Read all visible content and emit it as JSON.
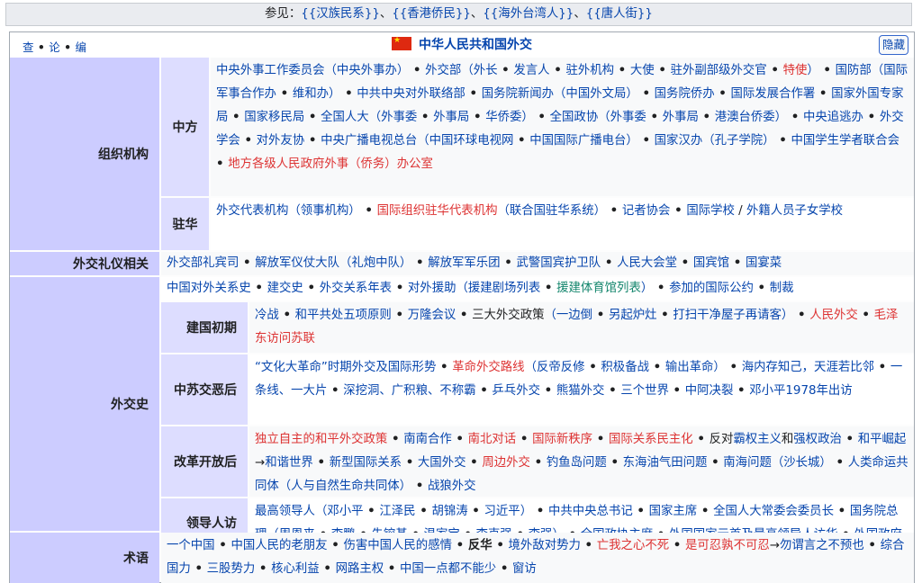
{
  "see_also": {
    "label": "参见：",
    "links": [
      "{{汉族民系}}",
      "{{香港侨民}}",
      "{{海外台湾人}}",
      "{{唐人街}}"
    ],
    "sep": "、"
  },
  "vde": {
    "v": "查",
    "d": "论",
    "e": "编"
  },
  "title": "中华人民共和国外交",
  "hide_label": "隐藏",
  "groups": {
    "org": "组织机构",
    "ceremony": "外交礼仪相关",
    "history": "外交史",
    "terms": "术语"
  },
  "subgroups": {
    "zhongfang": "中方",
    "zhuhua": "驻华",
    "jianguo": "建国初期",
    "zhongsu": "中苏交恶后",
    "gaige": "改革开放后",
    "lingdao": "领导人访问列表"
  },
  "rows": {
    "zhongfang": [
      {
        "t": "中央外事工作委员会",
        "c": "a"
      },
      {
        "t": "（中央外事办）",
        "c": "a"
      },
      {
        "t": " • ",
        "c": "dot"
      },
      {
        "t": "外交部",
        "c": "a"
      },
      {
        "t": "（外长",
        "c": "a"
      },
      {
        "t": " • ",
        "c": "dot"
      },
      {
        "t": "发言人",
        "c": "a"
      },
      {
        "t": " • ",
        "c": "dot"
      },
      {
        "t": "驻外机构",
        "c": "a"
      },
      {
        "t": " • ",
        "c": "dot"
      },
      {
        "t": "大使",
        "c": "a"
      },
      {
        "t": " • ",
        "c": "dot"
      },
      {
        "t": "驻外副部级外交官",
        "c": "a"
      },
      {
        "t": " • ",
        "c": "dot"
      },
      {
        "t": "特使",
        "c": "r"
      },
      {
        "t": "）",
        "c": "a"
      },
      {
        "t": " • ",
        "c": "dot"
      },
      {
        "t": "国防部",
        "c": "a"
      },
      {
        "t": "（国际军事合作办",
        "c": "a"
      },
      {
        "t": " • ",
        "c": "dot"
      },
      {
        "t": "维和办）",
        "c": "a"
      },
      {
        "t": " • ",
        "c": "dot"
      },
      {
        "t": "中共中央对外联络部",
        "c": "a"
      },
      {
        "t": " • ",
        "c": "dot"
      },
      {
        "t": "国务院新闻办",
        "c": "a"
      },
      {
        "t": "（中国外文局）",
        "c": "a"
      },
      {
        "t": " • ",
        "c": "dot"
      },
      {
        "t": "国务院侨办",
        "c": "a"
      },
      {
        "t": " • ",
        "c": "dot"
      },
      {
        "t": "国际发展合作署",
        "c": "a"
      },
      {
        "t": " • ",
        "c": "dot"
      },
      {
        "t": "国家外国专家局",
        "c": "a"
      },
      {
        "t": " • ",
        "c": "dot"
      },
      {
        "t": "国家移民局",
        "c": "a"
      },
      {
        "t": " • ",
        "c": "dot"
      },
      {
        "t": "全国人大",
        "c": "a"
      },
      {
        "t": "（外事委",
        "c": "a"
      },
      {
        "t": " • ",
        "c": "dot"
      },
      {
        "t": "外事局",
        "c": "a"
      },
      {
        "t": " • ",
        "c": "dot"
      },
      {
        "t": "华侨委）",
        "c": "a"
      },
      {
        "t": " • ",
        "c": "dot"
      },
      {
        "t": "全国政协",
        "c": "a"
      },
      {
        "t": "（外事委",
        "c": "a"
      },
      {
        "t": " • ",
        "c": "dot"
      },
      {
        "t": "外事局",
        "c": "a"
      },
      {
        "t": " • ",
        "c": "dot"
      },
      {
        "t": "港澳台侨委）",
        "c": "a"
      },
      {
        "t": " • ",
        "c": "dot"
      },
      {
        "t": "中央追逃办",
        "c": "a"
      },
      {
        "t": " • ",
        "c": "dot"
      },
      {
        "t": "外交学会",
        "c": "a"
      },
      {
        "t": " • ",
        "c": "dot"
      },
      {
        "t": "对外友协",
        "c": "a"
      },
      {
        "t": " • ",
        "c": "dot"
      },
      {
        "t": "中央广播电视总台",
        "c": "a"
      },
      {
        "t": "（中国环球电视网",
        "c": "a"
      },
      {
        "t": " • ",
        "c": "dot"
      },
      {
        "t": "中国国际广播电台）",
        "c": "a"
      },
      {
        "t": " • ",
        "c": "dot"
      },
      {
        "t": "国家汉办",
        "c": "a"
      },
      {
        "t": "（孔子学院）",
        "c": "a"
      },
      {
        "t": " • ",
        "c": "dot"
      },
      {
        "t": "中国学生学者联合会",
        "c": "a"
      },
      {
        "t": " • ",
        "c": "dot"
      },
      {
        "t": "地方各级人民政府外事（侨务）办公室",
        "c": "r"
      }
    ],
    "zhuhua": [
      {
        "t": "外交代表机构",
        "c": "a"
      },
      {
        "t": "（领事机构）",
        "c": "a"
      },
      {
        "t": " • ",
        "c": "dot"
      },
      {
        "t": "国际组织驻华代表机构",
        "c": "r"
      },
      {
        "t": "（联合国驻华系统）",
        "c": "a"
      },
      {
        "t": " • ",
        "c": "dot"
      },
      {
        "t": "记者协会",
        "c": "a"
      },
      {
        "t": " • ",
        "c": "dot"
      },
      {
        "t": "国际学校",
        "c": "a"
      },
      {
        "t": " / ",
        "c": "t"
      },
      {
        "t": "外籍人员子女学校",
        "c": "a"
      }
    ],
    "ceremony": [
      {
        "t": "外交部礼宾司",
        "c": "a"
      },
      {
        "t": " • ",
        "c": "dot"
      },
      {
        "t": "解放军仪仗大队",
        "c": "a"
      },
      {
        "t": "（礼炮中队）",
        "c": "a"
      },
      {
        "t": " • ",
        "c": "dot"
      },
      {
        "t": "解放军军乐团",
        "c": "a"
      },
      {
        "t": " • ",
        "c": "dot"
      },
      {
        "t": "武警国宾护卫队",
        "c": "a"
      },
      {
        "t": " • ",
        "c": "dot"
      },
      {
        "t": "人民大会堂",
        "c": "a"
      },
      {
        "t": " • ",
        "c": "dot"
      },
      {
        "t": "国宾馆",
        "c": "a"
      },
      {
        "t": " • ",
        "c": "dot"
      },
      {
        "t": "国宴菜",
        "c": "a"
      }
    ],
    "history_top": [
      {
        "t": "中国对外关系史",
        "c": "a"
      },
      {
        "t": " • ",
        "c": "dot"
      },
      {
        "t": "建交史",
        "c": "a"
      },
      {
        "t": " • ",
        "c": "dot"
      },
      {
        "t": "外交关系年表",
        "c": "a"
      },
      {
        "t": " • ",
        "c": "dot"
      },
      {
        "t": "对外援助",
        "c": "a"
      },
      {
        "t": "（援建剧场列表",
        "c": "a"
      },
      {
        "t": " • ",
        "c": "dot"
      },
      {
        "t": "援建体育馆列表",
        "c": "g"
      },
      {
        "t": "）",
        "c": "a"
      },
      {
        "t": " • ",
        "c": "dot"
      },
      {
        "t": "参加的国际公约",
        "c": "a"
      },
      {
        "t": " • ",
        "c": "dot"
      },
      {
        "t": "制裁",
        "c": "a"
      }
    ],
    "jianguo": [
      {
        "t": "冷战",
        "c": "a"
      },
      {
        "t": " • ",
        "c": "dot"
      },
      {
        "t": "和平共处五项原则",
        "c": "a"
      },
      {
        "t": " • ",
        "c": "dot"
      },
      {
        "t": "万隆会议",
        "c": "a"
      },
      {
        "t": " • ",
        "c": "dot"
      },
      {
        "t": "三大外交政策",
        "c": "t"
      },
      {
        "t": "（一边倒",
        "c": "a"
      },
      {
        "t": " • ",
        "c": "dot"
      },
      {
        "t": "另起炉灶",
        "c": "a"
      },
      {
        "t": " • ",
        "c": "dot"
      },
      {
        "t": "打扫干净屋子再请客）",
        "c": "a"
      },
      {
        "t": " • ",
        "c": "dot"
      },
      {
        "t": "人民外交",
        "c": "r"
      },
      {
        "t": " • ",
        "c": "dot"
      },
      {
        "t": "毛泽东访问苏联",
        "c": "r"
      }
    ],
    "zhongsu": [
      {
        "t": "“文化大革命”时期外交及国际形势",
        "c": "a"
      },
      {
        "t": " • ",
        "c": "dot"
      },
      {
        "t": "革命外交路线",
        "c": "r"
      },
      {
        "t": "（反帝反修",
        "c": "a"
      },
      {
        "t": " • ",
        "c": "dot"
      },
      {
        "t": "积极备战",
        "c": "a"
      },
      {
        "t": " • ",
        "c": "dot"
      },
      {
        "t": "输出革命）",
        "c": "a"
      },
      {
        "t": " • ",
        "c": "dot"
      },
      {
        "t": "海内存知己，天涯若比邻",
        "c": "a"
      },
      {
        "t": " • ",
        "c": "dot"
      },
      {
        "t": "一条线、一大片",
        "c": "a"
      },
      {
        "t": " • ",
        "c": "dot"
      },
      {
        "t": "深挖洞、广积粮、不称霸",
        "c": "a"
      },
      {
        "t": " • ",
        "c": "dot"
      },
      {
        "t": "乒乓外交",
        "c": "a"
      },
      {
        "t": " • ",
        "c": "dot"
      },
      {
        "t": "熊猫外交",
        "c": "a"
      },
      {
        "t": " • ",
        "c": "dot"
      },
      {
        "t": "三个世界",
        "c": "a"
      },
      {
        "t": " • ",
        "c": "dot"
      },
      {
        "t": "中阿决裂",
        "c": "a"
      },
      {
        "t": " • ",
        "c": "dot"
      },
      {
        "t": "邓小平1978年出访",
        "c": "a"
      }
    ],
    "gaige": [
      {
        "t": "独立自主的和平外交政策",
        "c": "r"
      },
      {
        "t": " • ",
        "c": "dot"
      },
      {
        "t": "南南合作",
        "c": "a"
      },
      {
        "t": " • ",
        "c": "dot"
      },
      {
        "t": "南北对话",
        "c": "r"
      },
      {
        "t": " • ",
        "c": "dot"
      },
      {
        "t": "国际新秩序",
        "c": "r"
      },
      {
        "t": " • ",
        "c": "dot"
      },
      {
        "t": "国际关系民主化",
        "c": "r"
      },
      {
        "t": " • ",
        "c": "dot"
      },
      {
        "t": "反对",
        "c": "t"
      },
      {
        "t": "霸权主义",
        "c": "a"
      },
      {
        "t": "和",
        "c": "t"
      },
      {
        "t": "强权政治",
        "c": "a"
      },
      {
        "t": " • ",
        "c": "dot"
      },
      {
        "t": "和平崛起",
        "c": "a"
      },
      {
        "t": "→",
        "c": "t"
      },
      {
        "t": "和谐世界",
        "c": "a"
      },
      {
        "t": " • ",
        "c": "dot"
      },
      {
        "t": "新型国际关系",
        "c": "a"
      },
      {
        "t": " • ",
        "c": "dot"
      },
      {
        "t": "大国外交",
        "c": "a"
      },
      {
        "t": " • ",
        "c": "dot"
      },
      {
        "t": "周边外交",
        "c": "r"
      },
      {
        "t": " • ",
        "c": "dot"
      },
      {
        "t": "钓鱼岛问题",
        "c": "a"
      },
      {
        "t": " • ",
        "c": "dot"
      },
      {
        "t": "东海油气田问题",
        "c": "a"
      },
      {
        "t": " • ",
        "c": "dot"
      },
      {
        "t": "南海问题",
        "c": "a"
      },
      {
        "t": "（沙长城）",
        "c": "a"
      },
      {
        "t": " • ",
        "c": "dot"
      },
      {
        "t": "人类命运共同体",
        "c": "a"
      },
      {
        "t": "（人与自然生命共同体）",
        "c": "a"
      },
      {
        "t": " • ",
        "c": "dot"
      },
      {
        "t": "战狼外交",
        "c": "a"
      }
    ],
    "lingdao": [
      {
        "t": "最高领导人",
        "c": "a"
      },
      {
        "t": "（邓小平",
        "c": "a"
      },
      {
        "t": " • ",
        "c": "dot"
      },
      {
        "t": "江泽民",
        "c": "a"
      },
      {
        "t": " • ",
        "c": "dot"
      },
      {
        "t": "胡锦涛",
        "c": "a"
      },
      {
        "t": " • ",
        "c": "dot"
      },
      {
        "t": "习近平）",
        "c": "a"
      },
      {
        "t": " • ",
        "c": "dot"
      },
      {
        "t": "中共中央总书记",
        "c": "a"
      },
      {
        "t": " • ",
        "c": "dot"
      },
      {
        "t": "国家主席",
        "c": "a"
      },
      {
        "t": " • ",
        "c": "dot"
      },
      {
        "t": "全国人大常委会委员长",
        "c": "a"
      },
      {
        "t": " • ",
        "c": "dot"
      },
      {
        "t": "国务院总理",
        "c": "a"
      },
      {
        "t": "（周恩来",
        "c": "a"
      },
      {
        "t": " • ",
        "c": "dot"
      },
      {
        "t": "李鹏",
        "c": "a"
      },
      {
        "t": " • ",
        "c": "dot"
      },
      {
        "t": "朱镕基",
        "c": "a"
      },
      {
        "t": " • ",
        "c": "dot"
      },
      {
        "t": "温家宝",
        "c": "a"
      },
      {
        "t": " • ",
        "c": "dot"
      },
      {
        "t": "李克强",
        "c": "a"
      },
      {
        "t": " • ",
        "c": "dot"
      },
      {
        "t": "李强）",
        "c": "a"
      },
      {
        "t": " • ",
        "c": "dot"
      },
      {
        "t": "全国政协主席",
        "c": "a"
      },
      {
        "t": " • ",
        "c": "dot"
      },
      {
        "t": "外国国家元首及最高领导人访华",
        "c": "a"
      },
      {
        "t": " • ",
        "c": "dot"
      },
      {
        "t": "外国政府首脑访华",
        "c": "a"
      }
    ],
    "terms": [
      {
        "t": "一个中国",
        "c": "a"
      },
      {
        "t": " • ",
        "c": "dot"
      },
      {
        "t": "中国人民的老朋友",
        "c": "a"
      },
      {
        "t": " • ",
        "c": "dot"
      },
      {
        "t": "伤害中国人民的感情",
        "c": "a"
      },
      {
        "t": " • ",
        "c": "dot"
      },
      {
        "t": "反华",
        "c": "b"
      },
      {
        "t": " • ",
        "c": "dot"
      },
      {
        "t": "境外敌对势力",
        "c": "a"
      },
      {
        "t": " • ",
        "c": "dot"
      },
      {
        "t": "亡我之心不死",
        "c": "r"
      },
      {
        "t": " • ",
        "c": "dot"
      },
      {
        "t": "是可忍孰不可忍",
        "c": "r"
      },
      {
        "t": "→",
        "c": "t"
      },
      {
        "t": "勿谓言之不预也",
        "c": "a"
      },
      {
        "t": " • ",
        "c": "dot"
      },
      {
        "t": "综合国力",
        "c": "a"
      },
      {
        "t": " • ",
        "c": "dot"
      },
      {
        "t": "三股势力",
        "c": "a"
      },
      {
        "t": " • ",
        "c": "dot"
      },
      {
        "t": "核心利益",
        "c": "a"
      },
      {
        "t": " • ",
        "c": "dot"
      },
      {
        "t": "网路主权",
        "c": "a"
      },
      {
        "t": " • ",
        "c": "dot"
      },
      {
        "t": "中国一点都不能少",
        "c": "a"
      },
      {
        "t": " • ",
        "c": "dot"
      },
      {
        "t": "窗访",
        "c": "a"
      }
    ]
  },
  "colors": {
    "link": "#0645ad",
    "redlink": "#d33",
    "visited": "#14866d",
    "group": "#ccccff",
    "subgroup": "#ddddff"
  }
}
